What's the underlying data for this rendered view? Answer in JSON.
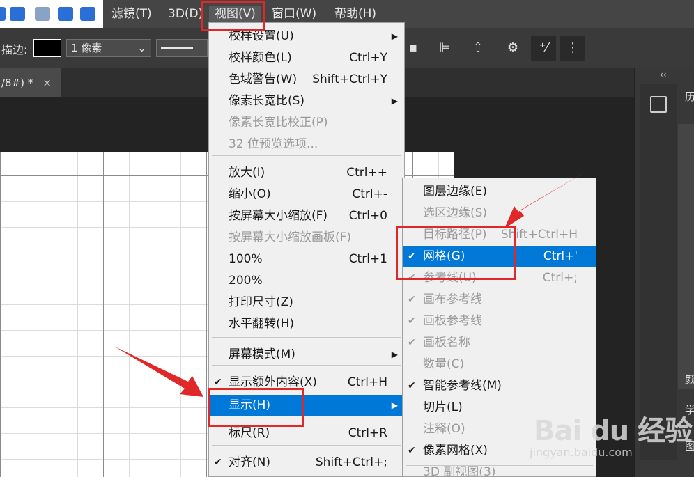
{
  "menubar": {
    "items": [
      "滤镜(T)",
      "3D(D)",
      "视图(V)",
      "窗口(W)",
      "帮助(H)"
    ]
  },
  "options": {
    "stroke_label": "描边:",
    "stroke_width": "1 像素"
  },
  "document": {
    "tab_title": "/8#) *",
    "close": "×"
  },
  "panels": {
    "collapse": "‹‹",
    "labels": [
      "历",
      "颜",
      "学",
      "图"
    ]
  },
  "view_menu": {
    "items": [
      {
        "label": "校样设置(U)",
        "shortcut": "",
        "disabled": false,
        "submenu": true,
        "checked": false
      },
      {
        "label": "校样颜色(L)",
        "shortcut": "Ctrl+Y",
        "disabled": false,
        "submenu": false,
        "checked": false
      },
      {
        "label": "色域警告(W)",
        "shortcut": "Shift+Ctrl+Y",
        "disabled": false,
        "submenu": false,
        "checked": false
      },
      {
        "label": "像素长宽比(S)",
        "shortcut": "",
        "disabled": false,
        "submenu": true,
        "checked": false
      },
      {
        "label": "像素长宽比校正(P)",
        "shortcut": "",
        "disabled": true,
        "submenu": false,
        "checked": false
      },
      {
        "label": "32 位预览选项...",
        "shortcut": "",
        "disabled": true,
        "submenu": false,
        "checked": false
      },
      {
        "label": "放大(I)",
        "shortcut": "Ctrl++",
        "disabled": false,
        "submenu": false,
        "checked": false
      },
      {
        "label": "缩小(O)",
        "shortcut": "Ctrl+-",
        "disabled": false,
        "submenu": false,
        "checked": false
      },
      {
        "label": "按屏幕大小缩放(F)",
        "shortcut": "Ctrl+0",
        "disabled": false,
        "submenu": false,
        "checked": false
      },
      {
        "label": "按屏幕大小缩放画板(F)",
        "shortcut": "",
        "disabled": true,
        "submenu": false,
        "checked": false
      },
      {
        "label": "100%",
        "shortcut": "Ctrl+1",
        "disabled": false,
        "submenu": false,
        "checked": false
      },
      {
        "label": "200%",
        "shortcut": "",
        "disabled": false,
        "submenu": false,
        "checked": false
      },
      {
        "label": "打印尺寸(Z)",
        "shortcut": "",
        "disabled": false,
        "submenu": false,
        "checked": false
      },
      {
        "label": "水平翻转(H)",
        "shortcut": "",
        "disabled": false,
        "submenu": false,
        "checked": false
      },
      {
        "label": "屏幕模式(M)",
        "shortcut": "",
        "disabled": false,
        "submenu": true,
        "checked": false
      },
      {
        "label": "显示额外内容(X)",
        "shortcut": "Ctrl+H",
        "disabled": false,
        "submenu": false,
        "checked": true
      },
      {
        "label": "显示(H)",
        "shortcut": "",
        "disabled": false,
        "submenu": true,
        "checked": false,
        "highlighted": true
      },
      {
        "label": "标尺(R)",
        "shortcut": "Ctrl+R",
        "disabled": false,
        "submenu": false,
        "checked": false
      },
      {
        "label": "对齐(N)",
        "shortcut": "Shift+Ctrl+;",
        "disabled": false,
        "submenu": false,
        "checked": true
      }
    ]
  },
  "show_submenu": {
    "items": [
      {
        "label": "图层边缘(E)",
        "shortcut": "",
        "disabled": false,
        "checked": false
      },
      {
        "label": "选区边缘(S)",
        "shortcut": "",
        "disabled": true,
        "checked": false
      },
      {
        "label": "目标路径(P)",
        "shortcut": "Shift+Ctrl+H",
        "disabled": true,
        "checked": false
      },
      {
        "label": "网格(G)",
        "shortcut": "Ctrl+'",
        "disabled": false,
        "checked": true,
        "highlighted": true
      },
      {
        "label": "参考线(U)",
        "shortcut": "Ctrl+;",
        "disabled": true,
        "checked": true
      },
      {
        "label": "画布参考线",
        "shortcut": "",
        "disabled": true,
        "checked": true
      },
      {
        "label": "画板参考线",
        "shortcut": "",
        "disabled": true,
        "checked": true
      },
      {
        "label": "画板名称",
        "shortcut": "",
        "disabled": true,
        "checked": true
      },
      {
        "label": "数量(C)",
        "shortcut": "",
        "disabled": true,
        "checked": false
      },
      {
        "label": "智能参考线(M)",
        "shortcut": "",
        "disabled": false,
        "checked": true
      },
      {
        "label": "切片(L)",
        "shortcut": "",
        "disabled": false,
        "checked": false
      },
      {
        "label": "注释(O)",
        "shortcut": "",
        "disabled": true,
        "checked": false
      },
      {
        "label": "像素网格(X)",
        "shortcut": "",
        "disabled": false,
        "checked": true
      },
      {
        "label": "3D 副视图(3)",
        "shortcut": "",
        "disabled": true,
        "checked": false
      }
    ]
  },
  "watermark": {
    "main": "Bai du 经验",
    "sub": "jingyan.baidu.com"
  },
  "colors": {
    "highlight": "#0078d7",
    "annotation": "#e02828",
    "menu_bg": "#f0f0f0"
  }
}
